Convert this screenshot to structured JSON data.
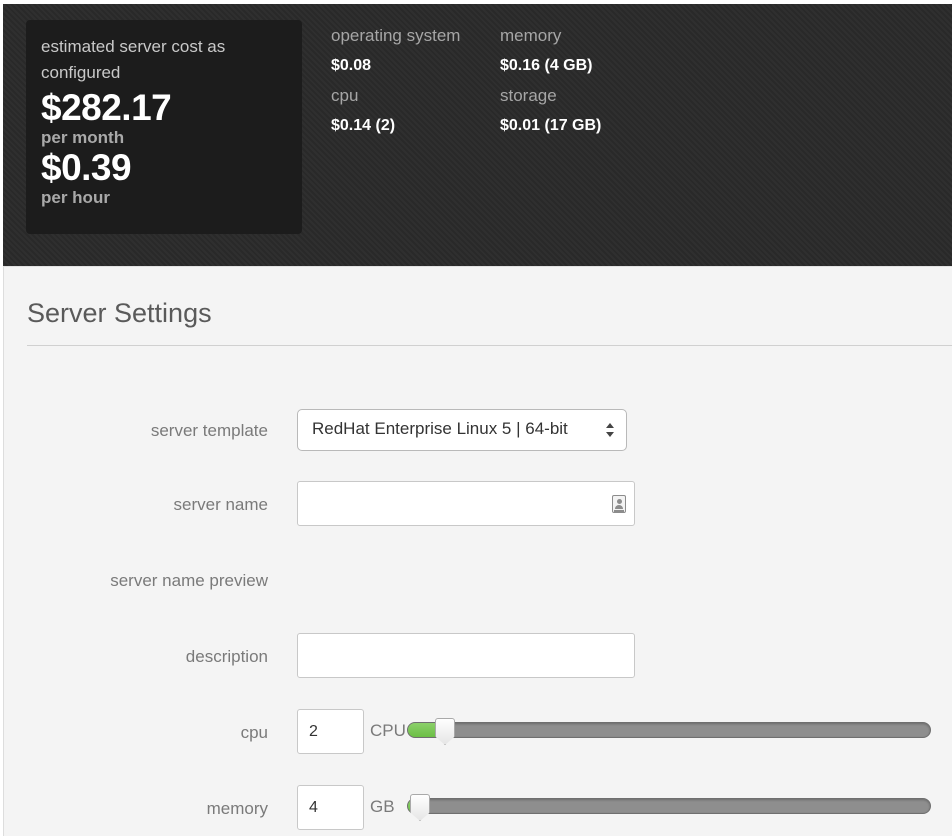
{
  "cost": {
    "caption": "estimated server cost as configured",
    "monthly": "$282.17",
    "monthly_unit": "per month",
    "hourly": "$0.39",
    "hourly_unit": "per hour"
  },
  "breakdown": {
    "os_label": "operating system",
    "os_value": "$0.08",
    "cpu_label": "cpu",
    "cpu_value": "$0.14 (2)",
    "memory_label": "memory",
    "memory_value": "$0.16 (4 GB)",
    "storage_label": "storage",
    "storage_value": "$0.01 (17 GB)"
  },
  "settings": {
    "title": "Server Settings",
    "template_label": "server template",
    "template_value": "RedHat Enterprise Linux 5 | 64-bit",
    "name_label": "server name",
    "name_value": "",
    "preview_label": "server name preview",
    "description_label": "description",
    "description_value": "",
    "cpu_label": "cpu",
    "cpu_value": "2",
    "cpu_unit": "CPU",
    "cpu_slider_fraction": 0.05,
    "memory_label": "memory",
    "memory_value": "4",
    "memory_unit": "GB",
    "memory_slider_fraction": 0.0
  },
  "colors": {
    "slider_fill": "#6cbf45",
    "panel_dark": "#2b2b2b"
  },
  "icons": {
    "name_field_icon": "contact-card-icon",
    "select_arrows": "up-down-arrows-icon"
  }
}
